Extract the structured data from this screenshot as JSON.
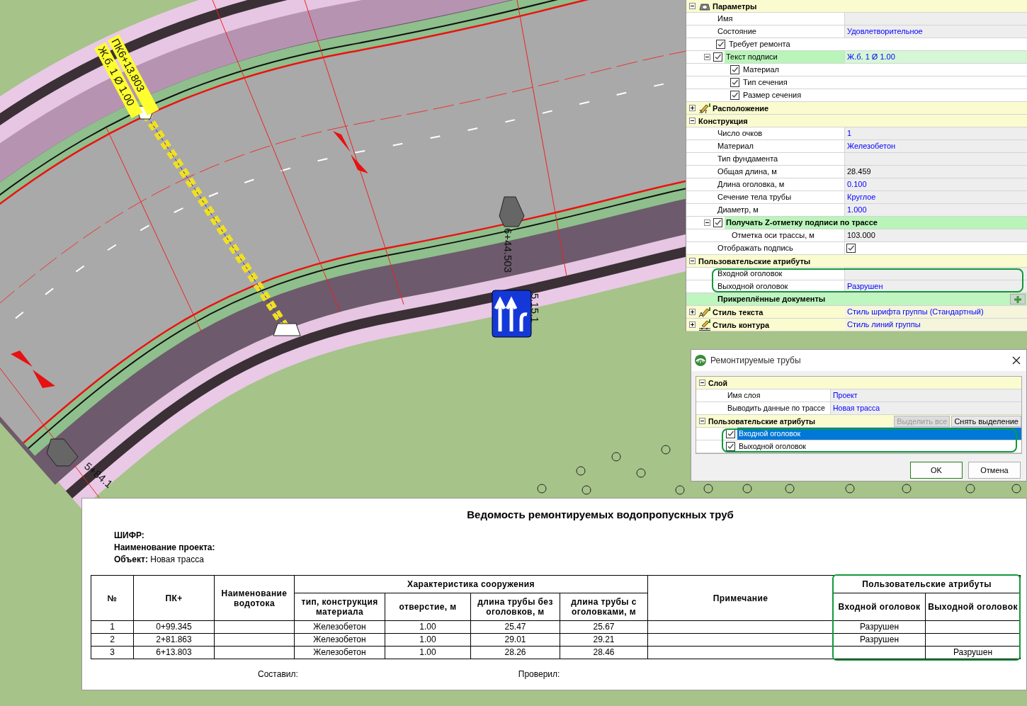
{
  "map": {
    "labels": [
      {
        "kind": "pipe_station",
        "text": "ПК6+13.803"
      },
      {
        "kind": "pipe_caption",
        "text": "Ж.б. 1 Ø 1.00"
      },
      {
        "kind": "station",
        "text": "6+44.503"
      },
      {
        "kind": "sign_code",
        "text": "5.15.1"
      },
      {
        "kind": "station_low",
        "text": "5+84.1"
      }
    ]
  },
  "properties": [
    {
      "kind": "section",
      "label": "Параметры",
      "expanded": true,
      "children": [
        {
          "kind": "field",
          "label": "Имя"
        },
        {
          "kind": "field",
          "label": "Состояние",
          "value": "Удовлетворительное",
          "changed": true
        },
        {
          "kind": "check",
          "label": "Требует ремонта",
          "checked": true
        },
        {
          "kind": "check",
          "label": "Текст подписи",
          "checked": true,
          "highlighted": true,
          "value": "Ж.б. 1 Ø 1.00",
          "changed": true,
          "expanded": true,
          "children": [
            {
              "kind": "check",
              "label": "Материал",
              "checked": true
            },
            {
              "kind": "check",
              "label": "Тип сечения",
              "checked": true
            },
            {
              "kind": "check",
              "label": "Размер сечения",
              "checked": true
            }
          ]
        }
      ]
    },
    {
      "kind": "section",
      "label": "Расположение",
      "expanded": false
    },
    {
      "kind": "section",
      "label": "Конструкция",
      "expanded": true,
      "children": [
        {
          "kind": "field",
          "label": "Число очков",
          "value": "1",
          "changed": true
        },
        {
          "kind": "field",
          "label": "Материал",
          "value": "Железобетон",
          "changed": true
        },
        {
          "kind": "field",
          "label": "Тип фундамента"
        },
        {
          "kind": "field",
          "label": "Общая длина, м",
          "value": "28.459",
          "changed": false
        },
        {
          "kind": "field",
          "label": "Длина оголовка, м",
          "value": "0.100",
          "changed": true
        },
        {
          "kind": "field",
          "label": "Сечение тела трубы",
          "value": "Круглое",
          "changed": true
        },
        {
          "kind": "field",
          "label": "Диаметр, м",
          "value": "1.000",
          "changed": true
        },
        {
          "kind": "check",
          "label": "Получать Z-отметку подписи по трассе",
          "checked": true,
          "highlighted": true,
          "expanded": true,
          "children": [
            {
              "kind": "field",
              "label": "Отметка оси трассы, м",
              "value": "103.000",
              "changed": false
            }
          ]
        },
        {
          "kind": "field_check",
          "label": "Отображать подпись",
          "checked": true
        }
      ]
    },
    {
      "kind": "section",
      "label": "Пользовательские атрибуты",
      "expanded": true,
      "children": [
        {
          "kind": "field",
          "label": "Входной оголовок",
          "outlined": true
        },
        {
          "kind": "field",
          "label": "Выходной оголовок",
          "value": "Разрушен",
          "changed": true,
          "outlined": true
        },
        {
          "kind": "docs",
          "label": "Прикреплённые документы"
        }
      ]
    },
    {
      "kind": "section",
      "label": "Стиль текста",
      "expanded": false,
      "value": "Стиль шрифта группы (Стандартный)"
    },
    {
      "kind": "section",
      "label": "Стиль контура",
      "expanded": false,
      "value": "Стиль линий группы"
    }
  ],
  "dialog": {
    "title": "Ремонтируемые трубы",
    "items": [
      {
        "kind": "section",
        "label": "Слой",
        "expanded": true,
        "children": [
          {
            "kind": "field",
            "label": "Имя слоя",
            "value": "Проект",
            "changed": true
          },
          {
            "kind": "field",
            "label": "Выводить данные по трассе",
            "value": "Новая трасса",
            "changed": true
          }
        ]
      },
      {
        "kind": "section",
        "label": "Пользовательские атрибуты",
        "expanded": true,
        "buttons": [
          {
            "label": "Выделить все",
            "disabled": true
          },
          {
            "label": "Снять выделение",
            "disabled": false
          }
        ],
        "children": [
          {
            "kind": "check",
            "label": "Входной оголовок",
            "checked": true,
            "selected": true,
            "outlined": true
          },
          {
            "kind": "check",
            "label": "Выходной оголовок",
            "checked": true,
            "selected": false,
            "outlined": true
          }
        ]
      }
    ],
    "buttons": [
      {
        "label": "OK",
        "default": true
      },
      {
        "label": "Отмена",
        "default": false
      }
    ]
  },
  "report": {
    "title": "Ведомость ремонтируемых водопропускных труб",
    "meta": [
      {
        "label": "ШИФР:"
      },
      {
        "label": "Наименование проекта:"
      },
      {
        "label": "Объект:",
        "value": "Новая трасса"
      }
    ],
    "columns": [
      {
        "label": "№"
      },
      {
        "label": "ПК+"
      },
      {
        "label": "Наименование водотока"
      },
      {
        "label": "Характеристика сооружения",
        "colspan": 4,
        "children": [
          {
            "label": "тип, конструкция материала"
          },
          {
            "label": "отверстие, м"
          },
          {
            "label": "длина трубы без оголовков, м"
          },
          {
            "label": "длина трубы с оголовками, м"
          }
        ]
      },
      {
        "label": "Примечание"
      },
      {
        "label": "Пользовательские атрибуты",
        "outlined": true,
        "colspan": 2,
        "children": [
          {
            "label": "Входной оголовок"
          },
          {
            "label": "Выходной оголовок"
          }
        ]
      }
    ],
    "rows": [
      [
        "1",
        "0+99.345",
        null,
        "Железобетон",
        "1.00",
        "25.47",
        "25.67",
        null,
        "Разрушен",
        null
      ],
      [
        "2",
        "2+81.863",
        null,
        "Железобетон",
        "1.00",
        "29.01",
        "29.21",
        null,
        "Разрушен",
        null
      ],
      [
        "3",
        "6+13.803",
        null,
        "Железобетон",
        "1.00",
        "28.26",
        "28.46",
        null,
        null,
        "Разрушен"
      ]
    ],
    "footer": [
      "Составил:",
      "Проверил:"
    ]
  }
}
